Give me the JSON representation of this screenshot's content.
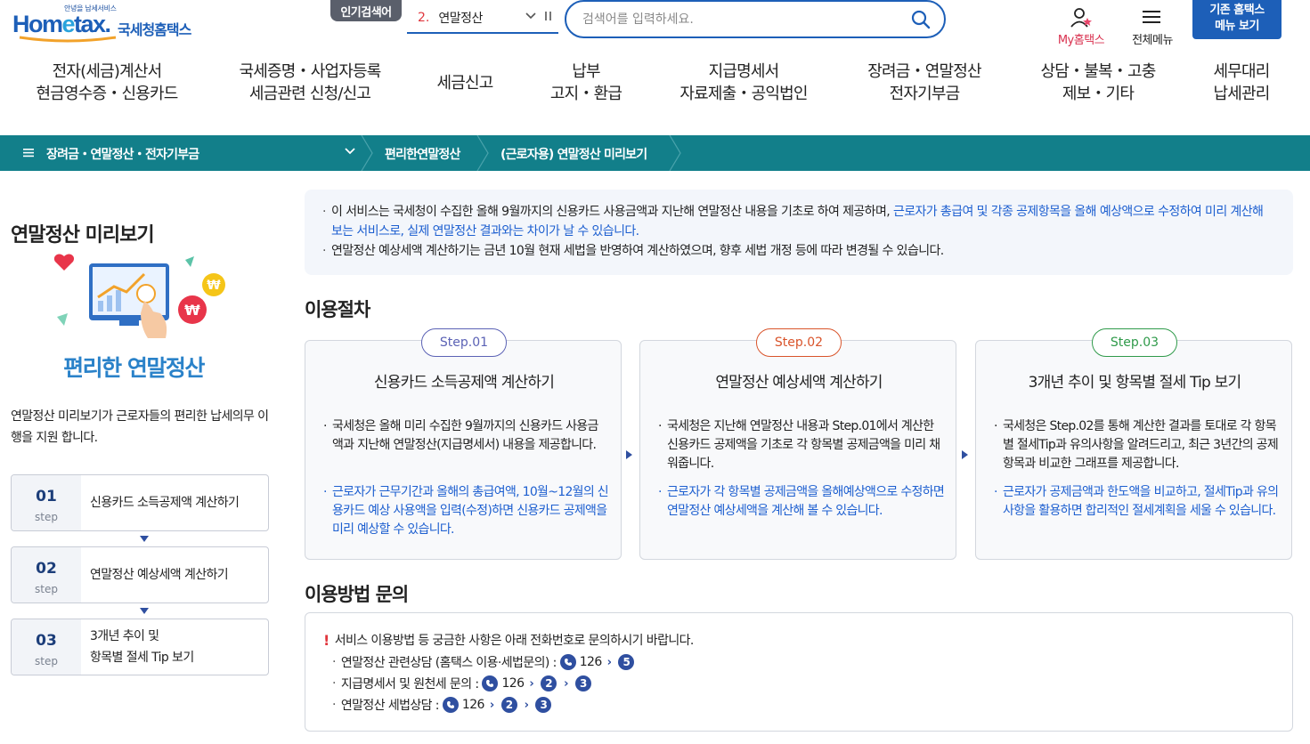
{
  "header": {
    "logo_tag": "안녕을 납세서비스",
    "logo_word_pre": "Hom",
    "logo_word_e": "e",
    "logo_word_post": "tax.",
    "logo_kr": "국세청홈택스",
    "popular_label": "인기검색어",
    "popular_rank": "2.",
    "popular_keyword": "연말정산",
    "search_placeholder": "검색어를 입력하세요.",
    "my_hometax": "My홈택스",
    "all_menu": "전체메뉴",
    "legacy_line1": "기존 홈택스",
    "legacy_line2": "메뉴 보기"
  },
  "gnb": [
    {
      "l1": "전자(세금)계산서",
      "l2": "현금영수증・신용카드"
    },
    {
      "l1": "국세증명・사업자등록",
      "l2": "세금관련 신청/신고"
    },
    {
      "l1": "세금신고",
      "l2": ""
    },
    {
      "l1": "납부",
      "l2": "고지・환급"
    },
    {
      "l1": "지급명세서",
      "l2": "자료제출・공익법인"
    },
    {
      "l1": "장려금・연말정산",
      "l2": "전자기부금"
    },
    {
      "l1": "상담・불복・고충",
      "l2": "제보・기타"
    },
    {
      "l1": "세무대리",
      "l2": "납세관리"
    }
  ],
  "breadcrumb": {
    "root": "장려금・연말정산・전자기부금",
    "level2": "편리한연말정산",
    "level3": "(근로자용) 연말정산 미리보기"
  },
  "left": {
    "title": "연말정산 미리보기",
    "hero_caption": "편리한 연말정산",
    "intro": "연말정산 미리보기가 근로자들의  편리한 납세의무 이행을 지원 합니다.",
    "steps": [
      {
        "num": "01",
        "sub": "step",
        "title": "신용카드 소득공제액 계산하기"
      },
      {
        "num": "02",
        "sub": "step",
        "title": "연말정산 예상세액 계산하기"
      },
      {
        "num": "03",
        "sub": "step",
        "title_l1": "3개년 추이 및",
        "title_l2": "항목별 절세 Tip 보기"
      }
    ]
  },
  "notice": {
    "line1_black": "이 서비스는 국세청이 수집한 올해 9월까지의 신용카드 사용금액과 지난해 연말정산 내용을 기초로 하여 제공하며, ",
    "line1_blue": "근로자가 총급여 및 각종 공제항목을 올해 예상액으로 수정하여 미리 계산해 보는 서비스로, 실제 연말정산 결과와는 차이가 날 수 있습니다.",
    "line2": "연말정산 예상세액 계산하기는 금년 10월 현재 세법을 반영하여 계산하였으며, 향후 세법 개정 등에 따라 변경될 수 있습니다."
  },
  "process": {
    "title": "이용절차",
    "cards": [
      {
        "badge": "Step.01",
        "badge_color": "#5b62b5",
        "title": "신용카드 소득공제액 계산하기",
        "desc": "국세청은 올해 미리 수집한 9월까지의 신용카드 사용금액과 지난해 연말정산(지급명세서) 내용을 제공합니다.",
        "note": "근로자가 근무기간과 올해의 총급여액, 10월~12월의 신용카드 예상 사용액을 입력(수정)하면 신용카드 공제액을 미리 예상할 수 있습니다."
      },
      {
        "badge": "Step.02",
        "badge_color": "#d9542b",
        "title": "연말정산 예상세액 계산하기",
        "desc": "국세청은 지난해 연말정산 내용과 Step.01에서 계산한 신용카드 공제액을 기초로 각 항목별 공제금액을 미리 채워줍니다.",
        "note": "근로자가 각 항목별 공제금액을 올해예상액으로 수정하면 연말정산 예상세액을 계산해 볼 수 있습니다."
      },
      {
        "badge": "Step.03",
        "badge_color": "#2f9a4a",
        "title": "3개년 추이 및 항목별 절세 Tip 보기",
        "desc": "국세청은 Step.02를 통해 계산한 결과를 토대로 각 항목별 절세Tip과 유의사항을 알려드리고, 최근 3년간의 공제항목과 비교한 그래프를 제공합니다.",
        "note": "근로자가 공제금액과 한도액을 비교하고, 절세Tip과 유의사항을 활용하면 합리적인 절세계획을 세울 수 있습니다."
      }
    ]
  },
  "contact": {
    "title": "이용방법 문의",
    "head_mark": "!",
    "head": "서비스 이용방법 등 궁금한 사항은 아래 전화번호로 문의하시기 바랍니다.",
    "rows": [
      {
        "label": "연말정산 관련상담 (홈택스 이용·세법문의) :",
        "number": "126",
        "steps": [
          "5"
        ]
      },
      {
        "label": "지급명세서 및 원천세 문의 :",
        "number": "126",
        "steps": [
          "2",
          "3"
        ]
      },
      {
        "label": "연말정산 세법상담 :",
        "number": "126",
        "steps": [
          "2",
          "3"
        ]
      }
    ]
  }
}
